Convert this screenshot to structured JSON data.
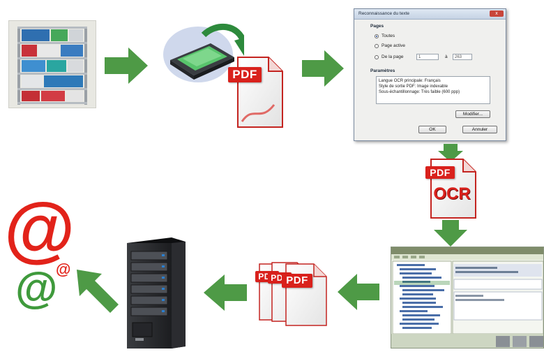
{
  "pdf_icons": {
    "label": "PDF"
  },
  "ocr_icon": {
    "pdf_label": "PDF",
    "ocr_label": "OCR"
  },
  "dialog": {
    "title": "Reconnaissance du texte",
    "close_label": "x",
    "pages_heading": "Pages",
    "option_all": "Toutes",
    "option_active": "Page active",
    "option_range": "De la page",
    "range_from": "1",
    "range_separator": "à",
    "range_to": "263",
    "params_heading": "Paramètres",
    "param_lines": [
      "Langue OCR principale: Français",
      "Style de sortie PDF: Image indexable",
      "Sous-échantillonnage: Très faible (600 ppp)"
    ],
    "modify_button": "Modifier...",
    "ok_button": "OK",
    "cancel_button": "Annuler"
  },
  "at_symbols": {
    "large": "@",
    "medium": "@",
    "small": "@"
  },
  "colors": {
    "arrow_green": "#4e9a46",
    "pdf_red": "#d9211c",
    "at_red": "#e2231a",
    "at_green": "#3f9a3c"
  },
  "icons": [
    "shelf-photo",
    "scanner-icon",
    "server-icon",
    "software-screenshot"
  ]
}
